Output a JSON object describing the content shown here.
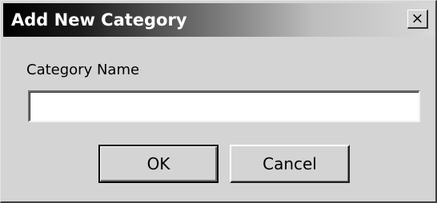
{
  "window": {
    "title": "Add New Category",
    "close_glyph": "×"
  },
  "form": {
    "label": "Category Name",
    "value": "",
    "placeholder": ""
  },
  "buttons": {
    "ok_label": "OK",
    "cancel_label": "Cancel"
  },
  "icons": {
    "close": "close-icon"
  }
}
